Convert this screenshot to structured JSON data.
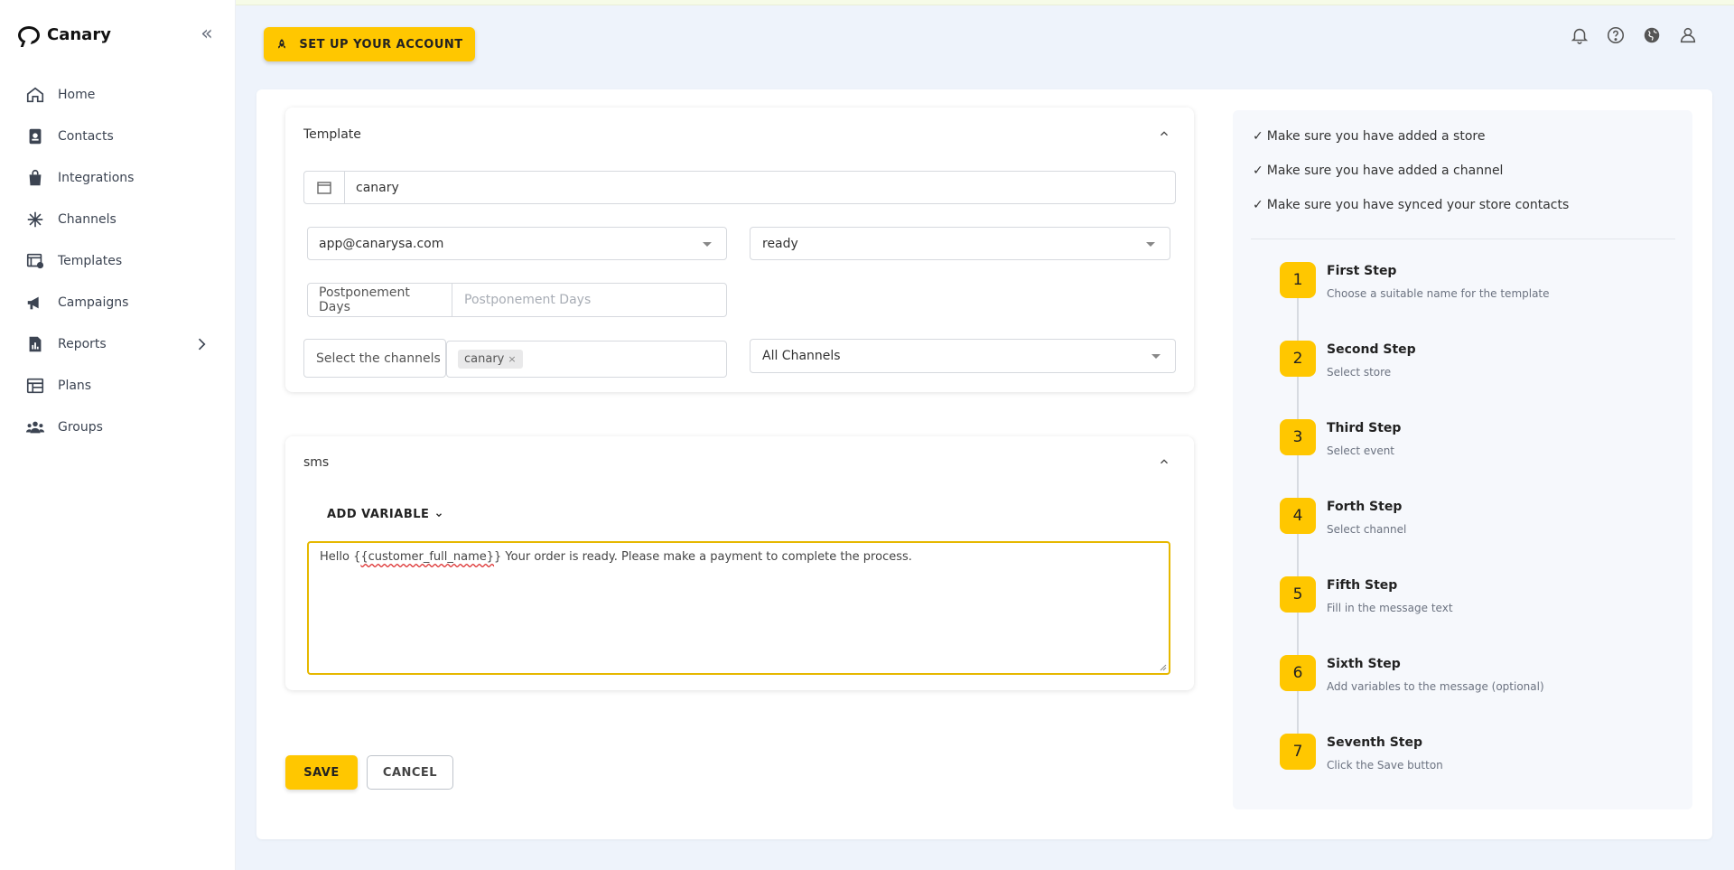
{
  "app": {
    "name": "Canary"
  },
  "sidebar": {
    "items": [
      {
        "label": "Home",
        "icon": "home-icon"
      },
      {
        "label": "Contacts",
        "icon": "contacts-icon"
      },
      {
        "label": "Integrations",
        "icon": "integrations-icon"
      },
      {
        "label": "Channels",
        "icon": "channels-icon"
      },
      {
        "label": "Templates",
        "icon": "templates-icon"
      },
      {
        "label": "Campaigns",
        "icon": "campaigns-icon"
      },
      {
        "label": "Reports",
        "icon": "reports-icon"
      },
      {
        "label": "Plans",
        "icon": "plans-icon"
      },
      {
        "label": "Groups",
        "icon": "groups-icon"
      }
    ]
  },
  "header": {
    "setup_label": "SET UP YOUR ACCOUNT",
    "icons": [
      "bell-icon",
      "help-icon",
      "globe-icon",
      "user-icon"
    ]
  },
  "template_panel": {
    "title": "Template",
    "name_value": "canary",
    "store_value": "app@canarysa.com",
    "event_value": "ready",
    "postponement_label": "Postponement Days",
    "postponement_placeholder": "Postponement Days",
    "channels_label": "Select the channels",
    "channel_chip": "canary",
    "channel_type_value": "All Channels"
  },
  "sms_panel": {
    "title": "sms",
    "add_variable_label": "ADD VARIABLE",
    "message_prefix": "Hello  {",
    "message_variable": "{customer_full_name}",
    "message_suffix": "} Your order is ready. Please make a payment to complete the process."
  },
  "actions": {
    "save_label": "SAVE",
    "cancel_label": "CANCEL"
  },
  "guide": {
    "checks": [
      "Make sure you have added a store",
      "Make sure you have added a channel",
      "Make sure you have synced your store contacts"
    ],
    "steps": [
      {
        "num": "1",
        "title": "First Step",
        "desc": "Choose a suitable name for the template"
      },
      {
        "num": "2",
        "title": "Second Step",
        "desc": "Select store"
      },
      {
        "num": "3",
        "title": "Third Step",
        "desc": "Select event"
      },
      {
        "num": "4",
        "title": "Forth Step",
        "desc": "Select channel"
      },
      {
        "num": "5",
        "title": "Fifth Step",
        "desc": "Fill in the message text"
      },
      {
        "num": "6",
        "title": "Sixth Step",
        "desc": "Add variables to the message (optional)"
      },
      {
        "num": "7",
        "title": "Seventh Step",
        "desc": "Click the Save button"
      }
    ]
  },
  "colors": {
    "accent": "#ffc700",
    "focus_border": "#e6b800",
    "background": "#eef3fb"
  }
}
